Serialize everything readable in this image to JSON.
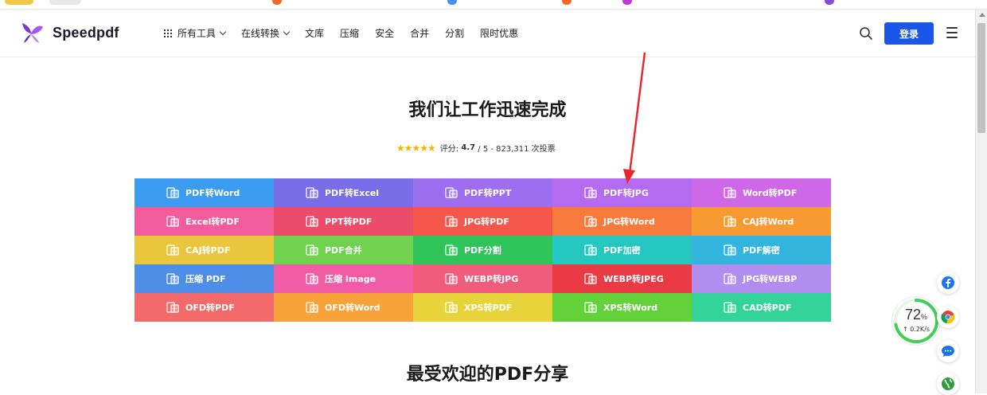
{
  "brand": {
    "name": "Speedpdf",
    "accent": "#1a57e8"
  },
  "nav": {
    "items": [
      {
        "label": "所有工具",
        "dropdown": true,
        "icon": "grid-icon"
      },
      {
        "label": "在线转换",
        "dropdown": true
      },
      {
        "label": "文库"
      },
      {
        "label": "压缩"
      },
      {
        "label": "安全"
      },
      {
        "label": "合并"
      },
      {
        "label": "分割"
      },
      {
        "label": "限时优惠"
      }
    ],
    "login_label": "登录"
  },
  "hero": {
    "title": "我们让工作迅速完成",
    "rating_label": "评分:",
    "rating_value": "4.7",
    "rating_suffix": "/ 5 - 823,311 次投票",
    "stars": "★★★★★"
  },
  "tools": [
    {
      "label": "PDF转Word",
      "color": "#3b9cf2"
    },
    {
      "label": "PDF转Excel",
      "color": "#7a6de8"
    },
    {
      "label": "PDF转PPT",
      "color": "#9d6ef0"
    },
    {
      "label": "PDF转JPG",
      "color": "#b46bf0"
    },
    {
      "label": "Word转PDF",
      "color": "#cf68e8"
    },
    {
      "label": "Excel转PDF",
      "color": "#f25c9b"
    },
    {
      "label": "PPT转PDF",
      "color": "#ea4c6a"
    },
    {
      "label": "JPG转PDF",
      "color": "#f5584a"
    },
    {
      "label": "JPG转Word",
      "color": "#f77b3c"
    },
    {
      "label": "CAJ转Word",
      "color": "#f89a32"
    },
    {
      "label": "CAJ转PDF",
      "color": "#e9c63c"
    },
    {
      "label": "PDF合并",
      "color": "#6fd14e"
    },
    {
      "label": "PDF分割",
      "color": "#2fc55a"
    },
    {
      "label": "PDF加密",
      "color": "#26c7c0"
    },
    {
      "label": "PDF解密",
      "color": "#33b5df"
    },
    {
      "label": "压缩 PDF",
      "color": "#4f8ee8"
    },
    {
      "label": "压缩 Image",
      "color": "#f25ca5"
    },
    {
      "label": "WEBP转JPG",
      "color": "#f25c7c"
    },
    {
      "label": "WEBP转JPEG",
      "color": "#ea3a44"
    },
    {
      "label": "JPG转WEBP",
      "color": "#b28df0"
    },
    {
      "label": "OFD转PDF",
      "color": "#f26a6a"
    },
    {
      "label": "OFD转Word",
      "color": "#f8a33a"
    },
    {
      "label": "XPS转PDF",
      "color": "#e6d43a"
    },
    {
      "label": "XPS转Word",
      "color": "#62d13a"
    },
    {
      "label": "CAD转PDF",
      "color": "#33d39a"
    }
  ],
  "section2": {
    "title": "最受欢迎的PDF分享"
  },
  "speed_widget": {
    "percent": "72",
    "percent_unit": "%",
    "rate": "↑ 0.2K/s",
    "ring_color": "#3fcf5a"
  },
  "side_buttons": [
    {
      "name": "facebook-icon",
      "color": "#1877f2"
    },
    {
      "name": "chrome-icon",
      "color": "#db4437"
    },
    {
      "name": "chat-icon",
      "color": "#1a73e8"
    },
    {
      "name": "globe-icon",
      "color": "#2e9a3e"
    }
  ]
}
